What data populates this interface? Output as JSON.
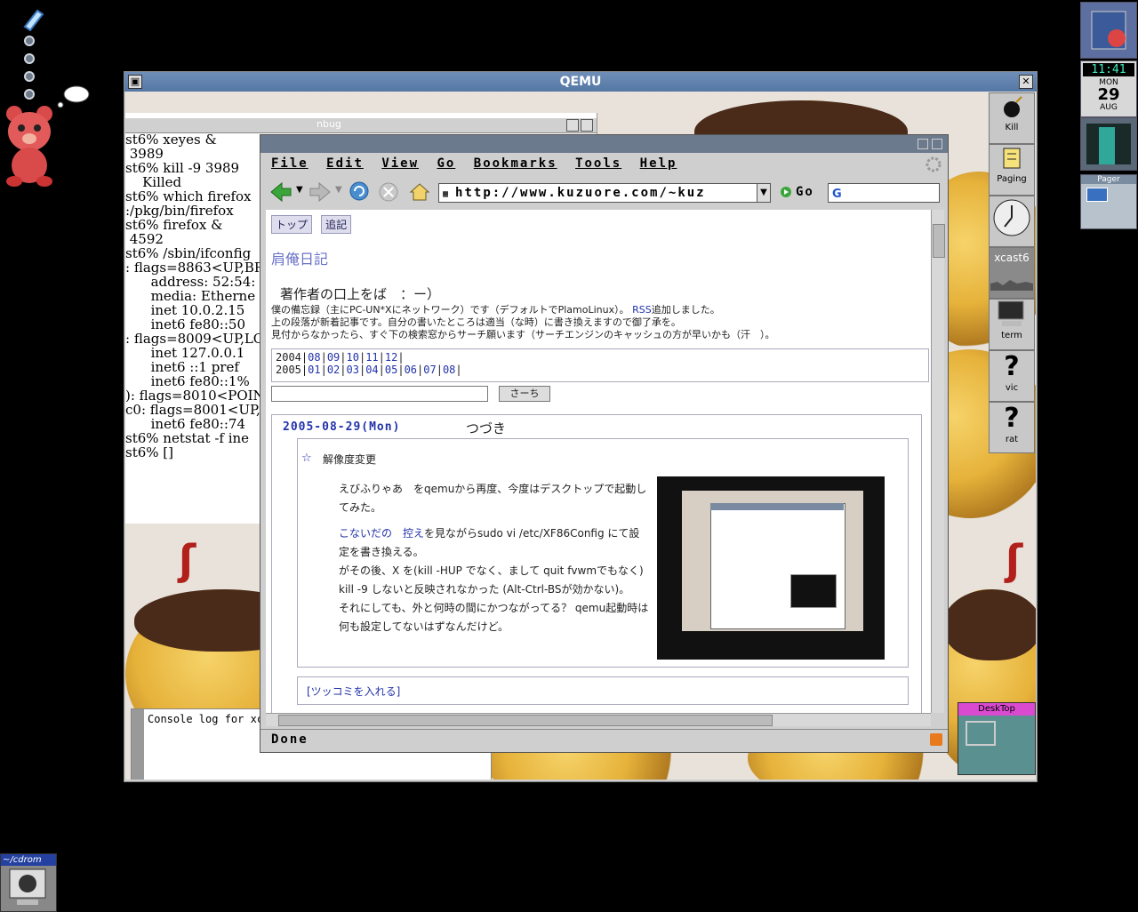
{
  "qemu": {
    "title": "QEMU"
  },
  "terminal": {
    "title": "nbug",
    "lines": "st6% xeyes &\n 3989\nst6% kill -9 3989\n    Killed\nst6% which firefox\n:/pkg/bin/firefox\nst6% firefox &\n 4592\nst6% /sbin/ifconfig\n: flags=8863<UP,BRO\n      address: 52:54:\n      media: Etherne\n      inet 10.0.2.15\n      inet6 fe80::50\n: flags=8009<UP,LOO\n      inet 127.0.0.1\n      inet6 ::1 pref\n      inet6 fe80::1%\n): flags=8010<POINTO\nc0: flags=8001<UP,MU\n      inet6 fe80::74\nst6% netstat -f ine\nst6% []",
    "console": "Console log for xca"
  },
  "firefox": {
    "menu": [
      "File",
      "Edit",
      "View",
      "Go",
      "Bookmarks",
      "Tools",
      "Help"
    ],
    "url": "http://www.kuzuore.com/~kuz",
    "go_label": "Go",
    "status": "Done"
  },
  "page": {
    "tabs": [
      "トップ",
      "追記"
    ],
    "title": "肩俺日記",
    "heading": "著作者の口上をば　：ー）",
    "intro1_pre": "僕の備忘録（主にPC-UN*Xにネットワーク）です（デフォルトでPlamoLinux）。",
    "intro1_link": "RSS",
    "intro1_post": "追加しました。",
    "intro2": "上の段落が新着記事です。自分の書いたところは適当（な時）に書き換えますので御了承を。",
    "intro3": "見付からなかったら、すぐ下の検索窓からサーチ願います（サーチエンジンのキャッシュの方が早いかも（汗　）。",
    "year2004": "2004",
    "months2004": [
      "08",
      "09",
      "10",
      "11",
      "12"
    ],
    "year2005": "2005",
    "months2005": [
      "01",
      "02",
      "03",
      "04",
      "05",
      "06",
      "07",
      "08"
    ],
    "search_button": "さーち",
    "entry_date": "2005-08-29(Mon)",
    "entry_title": "つづき",
    "section_star": "☆",
    "section_title": "解像度変更",
    "p1": "えびふりゃあ　をqemuから再度、今度はデスクトップで起動してみた。",
    "p2_link1": "こないだの",
    "p2_link2": "控え",
    "p2_rest": "を見ながらsudo vi /etc/XF86Config にて設定を書き換える。",
    "p3": "がその後、X を(kill -HUP でなく、まして quit fvwmでもなく) kill -9 しないと反映されなかった (Alt-Ctrl-BSが効かない)。",
    "p4": "それにしても、外と何時の間にかつながってる？ qemu起動時は何も設定してないはずなんだけど。",
    "comment_link": "[ツッコミを入れる]"
  },
  "dock": {
    "buttons": [
      "Kill",
      "Paging",
      "",
      "xcast6",
      "term",
      "vic",
      "rat"
    ],
    "time": "11:41",
    "weekday": "MON",
    "day": "29",
    "month": "AUG",
    "pager": "Pager",
    "desktop": "DeskTop",
    "shell": "~/cdrom"
  }
}
